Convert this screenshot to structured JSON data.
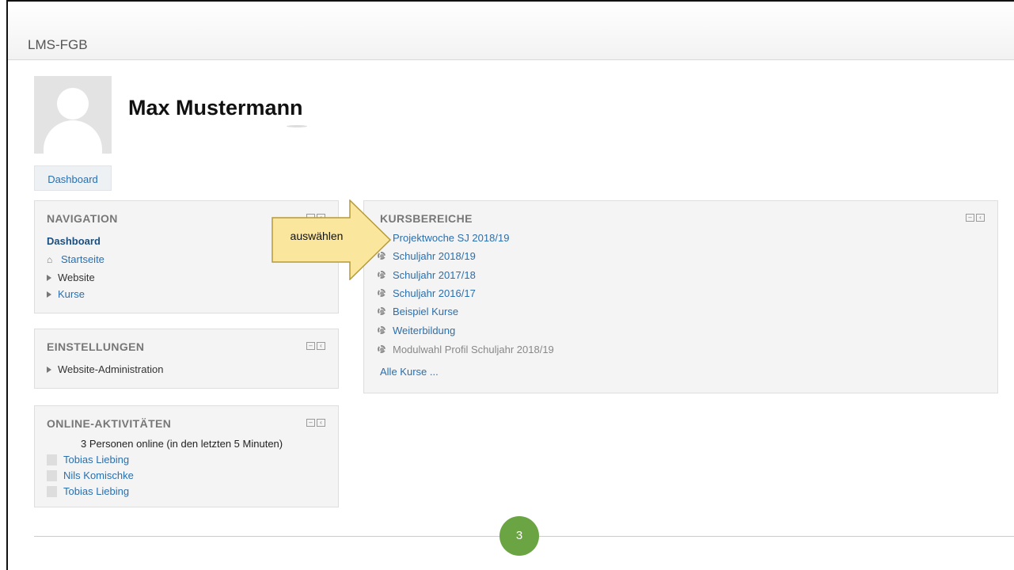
{
  "site": {
    "brand": "LMS-FGB"
  },
  "profile": {
    "name": "Max Mustermann",
    "dashboard_button": "Dashboard"
  },
  "navigation_block": {
    "title": "NAVIGATION",
    "items": {
      "dashboard": "Dashboard",
      "home": "Startseite",
      "website": "Website",
      "courses": "Kurse"
    }
  },
  "settings_block": {
    "title": "EINSTELLUNGEN",
    "items": {
      "site_admin": "Website-Administration"
    }
  },
  "online_block": {
    "title": "ONLINE-AKTIVITÄTEN",
    "summary": "3 Personen online (in den letzten 5 Minuten)",
    "users": [
      "Tobias Liebing",
      "Nils Komischke",
      "Tobias Liebing"
    ]
  },
  "categories_block": {
    "title": "KURSBEREICHE",
    "items": [
      "Projektwoche SJ 2018/19",
      "Schuljahr 2018/19",
      "Schuljahr 2017/18",
      "Schuljahr 2016/17",
      "Beispiel Kurse",
      "Weiterbildung",
      "Modulwahl Profil Schuljahr 2018/19"
    ],
    "all_courses": "Alle Kurse ..."
  },
  "annotation": {
    "arrow_label": "auswählen",
    "page_number": "3"
  },
  "colors": {
    "link": "#2a6fae",
    "arrow_fill": "#fbe69e",
    "page_badge": "#6aa443"
  },
  "icons": {
    "home": "home-icon",
    "expand": "triangle-right-icon",
    "category": "cog-icon",
    "block_hide": "minus-box-icon",
    "block_dock": "dock-left-icon"
  }
}
